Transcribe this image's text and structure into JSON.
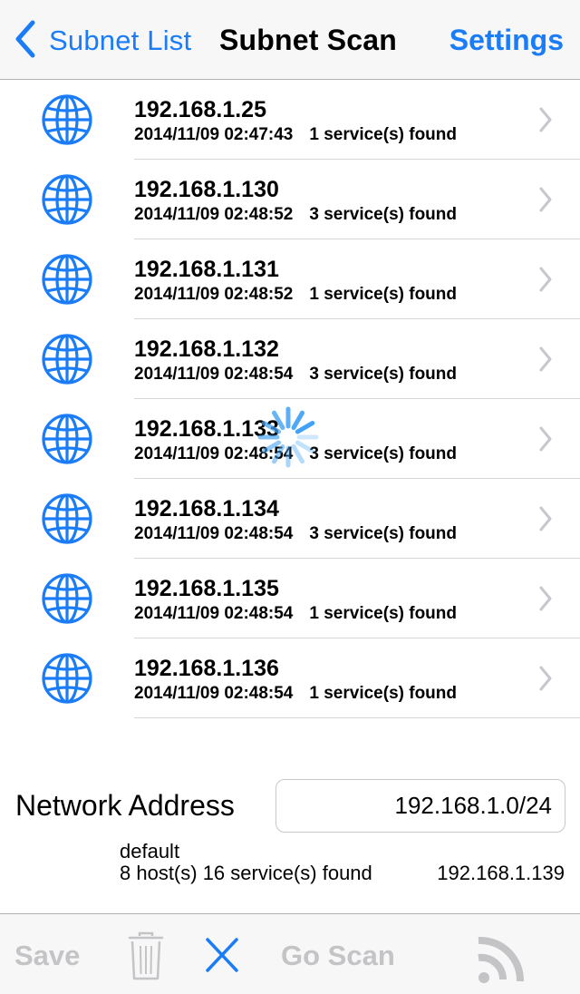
{
  "nav": {
    "back_label": "Subnet List",
    "title": "Subnet Scan",
    "settings_label": "Settings",
    "back_icon": "chevron-left-icon"
  },
  "hosts": [
    {
      "ip": "192.168.1.25",
      "time": "2014/11/09 02:47:43",
      "services": "1 service(s) found",
      "icon": "globe-icon"
    },
    {
      "ip": "192.168.1.130",
      "time": "2014/11/09 02:48:52",
      "services": "3 service(s) found",
      "icon": "globe-icon"
    },
    {
      "ip": "192.168.1.131",
      "time": "2014/11/09 02:48:52",
      "services": "1 service(s) found",
      "icon": "globe-icon"
    },
    {
      "ip": "192.168.1.132",
      "time": "2014/11/09 02:48:54",
      "services": "3 service(s) found",
      "icon": "globe-icon"
    },
    {
      "ip": "192.168.1.133",
      "time": "2014/11/09 02:48:54",
      "services": "3 service(s) found",
      "icon": "globe-icon"
    },
    {
      "ip": "192.168.1.134",
      "time": "2014/11/09 02:48:54",
      "services": "3 service(s) found",
      "icon": "globe-icon"
    },
    {
      "ip": "192.168.1.135",
      "time": "2014/11/09 02:48:54",
      "services": "1 service(s) found",
      "icon": "globe-icon"
    },
    {
      "ip": "192.168.1.136",
      "time": "2014/11/09 02:48:54",
      "services": "1 service(s) found",
      "icon": "globe-icon"
    }
  ],
  "network": {
    "label": "Network Address",
    "value": "192.168.1.0/24",
    "scan_name": "default",
    "summary": "8 host(s) 16 service(s) found",
    "current_ip": "192.168.1.139"
  },
  "toolbar": {
    "save_label": "Save",
    "go_scan_label": "Go Scan",
    "trash_icon": "trash-icon",
    "cancel_icon": "close-icon",
    "feed_icon": "rss-feed-icon"
  },
  "colors": {
    "accent": "#1a7cf6",
    "disabled": "#c4c4c6",
    "separator": "#d6d6da",
    "bar_background": "#f7f7f8"
  }
}
